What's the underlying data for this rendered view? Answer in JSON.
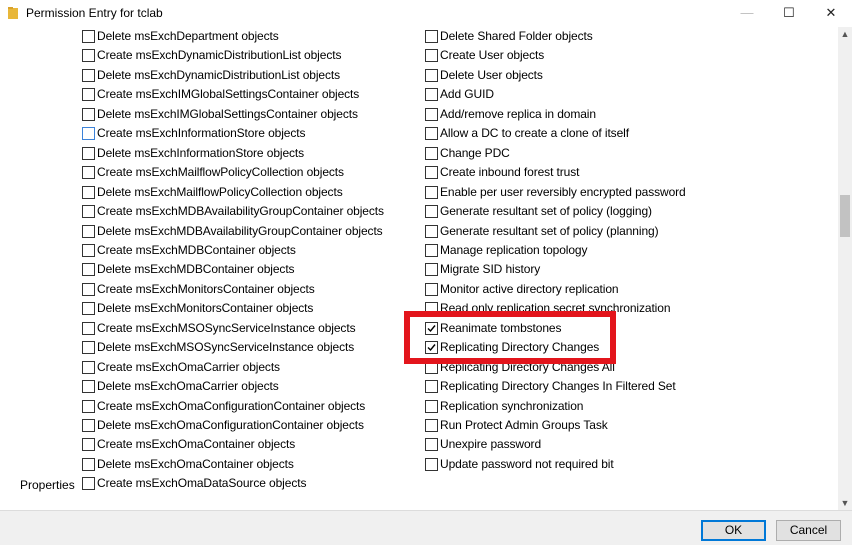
{
  "window": {
    "title": "Permission Entry for tclab",
    "minimize_glyph": "—",
    "maximize_glyph": "☐",
    "close_glyph": "✕"
  },
  "permissions": {
    "left": [
      {
        "label": "Delete msExchDepartment objects",
        "checked": false
      },
      {
        "label": "Create msExchDynamicDistributionList objects",
        "checked": false
      },
      {
        "label": "Delete msExchDynamicDistributionList objects",
        "checked": false
      },
      {
        "label": "Create msExchIMGlobalSettingsContainer objects",
        "checked": false
      },
      {
        "label": "Delete msExchIMGlobalSettingsContainer objects",
        "checked": false
      },
      {
        "label": "Create msExchInformationStore objects",
        "checked": false,
        "focused": true
      },
      {
        "label": "Delete msExchInformationStore objects",
        "checked": false
      },
      {
        "label": "Create msExchMailflowPolicyCollection objects",
        "checked": false
      },
      {
        "label": "Delete msExchMailflowPolicyCollection objects",
        "checked": false
      },
      {
        "label": "Create msExchMDBAvailabilityGroupContainer objects",
        "checked": false
      },
      {
        "label": "Delete msExchMDBAvailabilityGroupContainer objects",
        "checked": false
      },
      {
        "label": "Create msExchMDBContainer objects",
        "checked": false
      },
      {
        "label": "Delete msExchMDBContainer objects",
        "checked": false
      },
      {
        "label": "Create msExchMonitorsContainer objects",
        "checked": false
      },
      {
        "label": "Delete msExchMonitorsContainer objects",
        "checked": false
      },
      {
        "label": "Create msExchMSOSyncServiceInstance objects",
        "checked": false
      },
      {
        "label": "Delete msExchMSOSyncServiceInstance objects",
        "checked": false
      },
      {
        "label": "Create msExchOmaCarrier objects",
        "checked": false
      },
      {
        "label": "Delete msExchOmaCarrier objects",
        "checked": false
      },
      {
        "label": "Create msExchOmaConfigurationContainer objects",
        "checked": false
      },
      {
        "label": "Delete msExchOmaConfigurationContainer objects",
        "checked": false
      },
      {
        "label": "Create msExchOmaContainer objects",
        "checked": false
      },
      {
        "label": "Delete msExchOmaContainer objects",
        "checked": false
      },
      {
        "label": "Create msExchOmaDataSource objects",
        "checked": false
      }
    ],
    "right": [
      {
        "label": "Delete Shared Folder objects",
        "checked": false
      },
      {
        "label": "Create User objects",
        "checked": false
      },
      {
        "label": "Delete User objects",
        "checked": false
      },
      {
        "label": "Add GUID",
        "checked": false
      },
      {
        "label": "Add/remove replica in domain",
        "checked": false
      },
      {
        "label": "Allow a DC to create a clone of itself",
        "checked": false
      },
      {
        "label": "Change PDC",
        "checked": false
      },
      {
        "label": "Create inbound forest trust",
        "checked": false
      },
      {
        "label": "Enable per user reversibly encrypted password",
        "checked": false
      },
      {
        "label": "Generate resultant set of policy (logging)",
        "checked": false
      },
      {
        "label": "Generate resultant set of policy (planning)",
        "checked": false
      },
      {
        "label": "Manage replication topology",
        "checked": false
      },
      {
        "label": "Migrate SID history",
        "checked": false
      },
      {
        "label": "Monitor active directory replication",
        "checked": false
      },
      {
        "label": "Read only replication secret synchronization",
        "checked": false
      },
      {
        "label": "Reanimate tombstones",
        "checked": true
      },
      {
        "label": "Replicating Directory Changes",
        "checked": true
      },
      {
        "label": "Replicating Directory Changes All",
        "checked": false
      },
      {
        "label": "Replicating Directory Changes In Filtered Set",
        "checked": false
      },
      {
        "label": "Replication synchronization",
        "checked": false
      },
      {
        "label": "Run Protect Admin Groups Task",
        "checked": false
      },
      {
        "label": "Unexpire password",
        "checked": false
      },
      {
        "label": "Update password not required bit",
        "checked": false
      }
    ]
  },
  "properties_heading": "Properties",
  "scrollbar": {
    "up_glyph": "▲",
    "down_glyph": "▼"
  },
  "footer": {
    "ok_label": "OK",
    "cancel_label": "Cancel"
  },
  "colors": {
    "highlight": "#e3151c",
    "accent": "#0078d7",
    "folder_icon": "#e8b73a"
  }
}
